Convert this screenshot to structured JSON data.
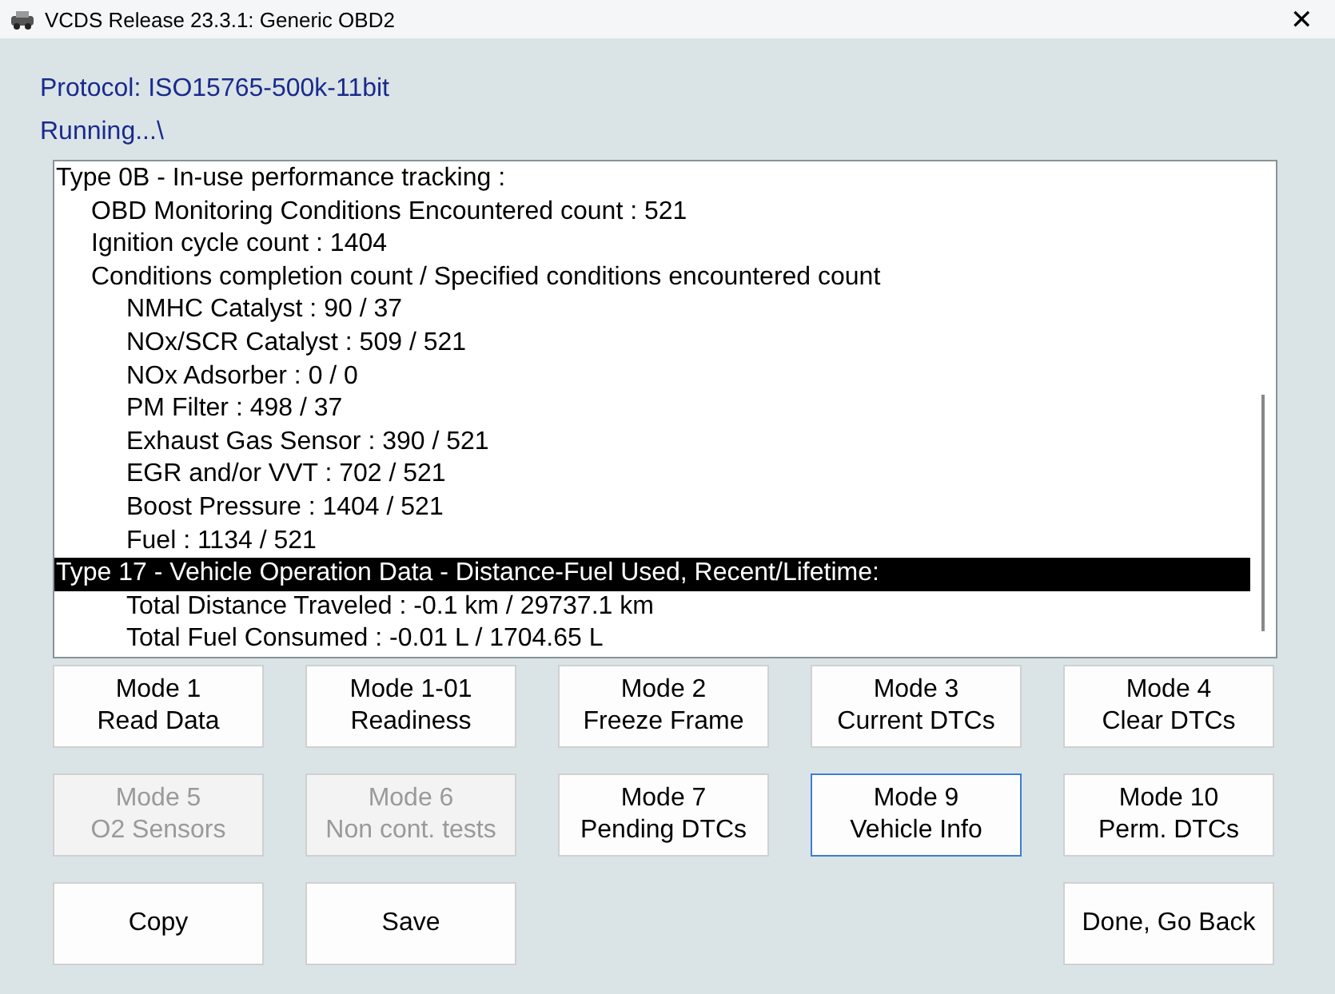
{
  "window": {
    "title": "VCDS Release 23.3.1:  Generic OBD2",
    "close": "✕"
  },
  "protocol": "Protocol: ISO15765-500k-11bit",
  "status": "Running...\\",
  "results": [
    {
      "text": "Type 0B - In-use performance tracking :",
      "selected": false,
      "children": [
        {
          "text": "OBD Monitoring Conditions Encountered count : 521"
        },
        {
          "text": "Ignition cycle count : 1404"
        },
        {
          "text": "Conditions completion count / Specified conditions encountered count",
          "children": [
            {
              "text": "NMHC Catalyst : 90 / 37"
            },
            {
              "text": "NOx/SCR Catalyst : 509 / 521"
            },
            {
              "text": "NOx Adsorber : 0 / 0"
            },
            {
              "text": "PM Filter : 498 / 37"
            },
            {
              "text": "Exhaust Gas Sensor : 390 / 521"
            },
            {
              "text": "EGR and/or VVT : 702 / 521"
            },
            {
              "text": "Boost Pressure : 1404 / 521"
            },
            {
              "text": "Fuel : 1134 / 521"
            }
          ]
        }
      ]
    },
    {
      "text": "Type 17 - Vehicle Operation Data - Distance-Fuel Used, Recent/Lifetime:",
      "selected": true,
      "children": [
        {
          "children": [
            {
              "text": "Total Distance Traveled : -0.1 km / 29737.1 km"
            },
            {
              "text": "Total Fuel Consumed : -0.01 L / 1704.65 L"
            }
          ]
        }
      ]
    }
  ],
  "mode_buttons": [
    [
      {
        "lines": [
          "Mode 1",
          "Read Data"
        ],
        "disabled": false,
        "selected": false
      },
      {
        "lines": [
          "Mode 1-01",
          "Readiness"
        ],
        "disabled": false,
        "selected": false
      },
      {
        "lines": [
          "Mode 2",
          "Freeze Frame"
        ],
        "disabled": false,
        "selected": false
      },
      {
        "lines": [
          "Mode 3",
          "Current DTCs"
        ],
        "disabled": false,
        "selected": false
      },
      {
        "lines": [
          "Mode 4",
          "Clear DTCs"
        ],
        "disabled": false,
        "selected": false
      }
    ],
    [
      {
        "lines": [
          "Mode 5",
          "O2 Sensors"
        ],
        "disabled": true,
        "selected": false
      },
      {
        "lines": [
          "Mode 6",
          "Non cont. tests"
        ],
        "disabled": true,
        "selected": false
      },
      {
        "lines": [
          "Mode 7",
          "Pending DTCs"
        ],
        "disabled": false,
        "selected": false
      },
      {
        "lines": [
          "Mode 9",
          "Vehicle Info"
        ],
        "disabled": false,
        "selected": true
      },
      {
        "lines": [
          "Mode 10",
          "Perm. DTCs"
        ],
        "disabled": false,
        "selected": false
      }
    ]
  ],
  "bottom_left_buttons": [
    "Copy",
    "Save"
  ],
  "bottom_right_buttons": [
    "Done, Go Back"
  ]
}
